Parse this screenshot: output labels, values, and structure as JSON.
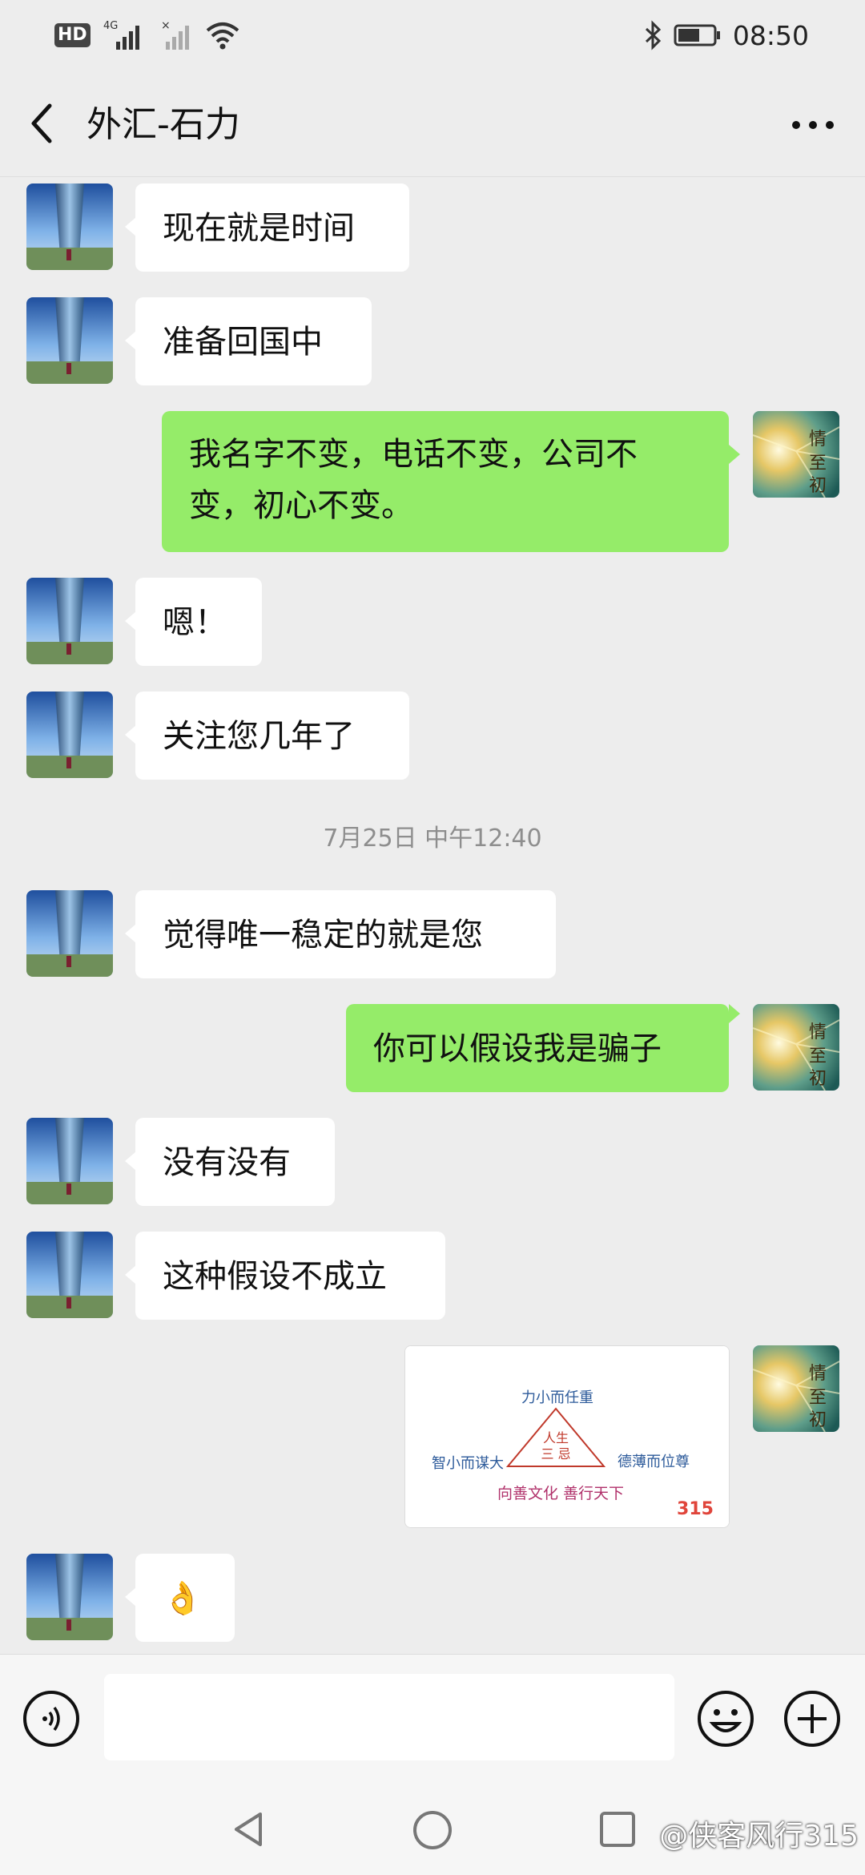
{
  "status_bar": {
    "network": "4G",
    "time": "08:50",
    "hd": "HD"
  },
  "chat": {
    "title": "外汇-石力"
  },
  "messages": [
    {
      "side": "in",
      "text": "现在就是时间"
    },
    {
      "side": "in",
      "text": "准备回国中"
    },
    {
      "side": "out",
      "line1": "我名字不变，电话不变，公司不",
      "line2": "变，初心不变。"
    },
    {
      "side": "in",
      "text": "嗯！"
    },
    {
      "side": "in",
      "text": "关注您几年了"
    },
    {
      "side": "in",
      "text": "觉得唯一稳定的就是您"
    },
    {
      "side": "out",
      "text": "你可以假设我是骗子"
    },
    {
      "side": "in",
      "text": "没有没有"
    },
    {
      "side": "in",
      "text": "这种假设不成立"
    },
    {
      "side": "in",
      "emoji": "👌"
    }
  ],
  "timestamp": "7月25日 中午12:40",
  "image_message": {
    "top": "力小而任重",
    "center1": "人生",
    "center2": "三 忌",
    "left": "智小而谋大",
    "right": "德薄而位尊",
    "bottom": "向善文化  善行天下",
    "badge": "315"
  },
  "watermark": "@侠客风行315",
  "colors": {
    "self_bubble": "#95ec69",
    "other_bubble": "#ffffff",
    "background": "#ededed"
  }
}
